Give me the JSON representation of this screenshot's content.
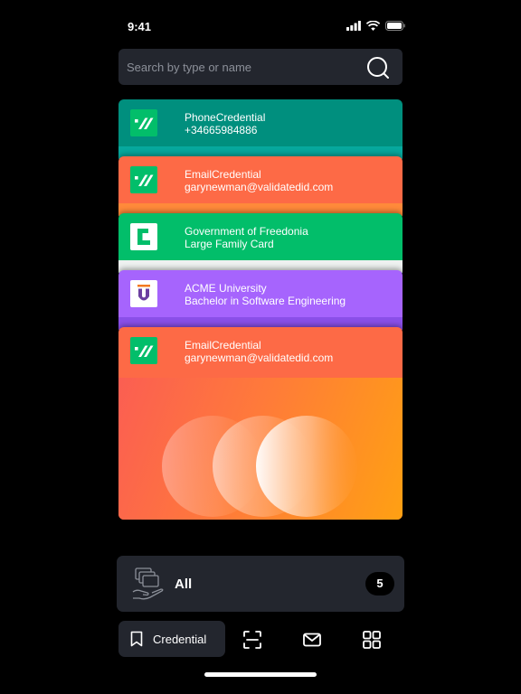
{
  "status_bar": {
    "time": "9:41"
  },
  "search": {
    "placeholder": "Search by type or name"
  },
  "cards": [
    {
      "title": "PhoneCredential",
      "subtitle": "+34665984886",
      "color": "#008f7e",
      "logo": "validated-id-logo"
    },
    {
      "title": "EmailCredential",
      "subtitle": "garynewman@validatedid.com",
      "color": "#fd6a46",
      "logo": "validated-id-logo"
    },
    {
      "title": "Government of Freedonia",
      "subtitle": "Large Family Card",
      "color": "#02be6a",
      "logo": "freedonia-logo"
    },
    {
      "title": "ACME University",
      "subtitle": "Bachelor in Software Engineering",
      "color": "#a664fd",
      "logo": "acme-university-logo"
    },
    {
      "title": "EmailCredential",
      "subtitle": "garynewman@validatedid.com",
      "color": "#fd6a46",
      "logo": "validated-id-logo"
    }
  ],
  "wallet": {
    "label": "All",
    "count": "5"
  },
  "nav": {
    "active_label": "Credential",
    "items": [
      "credential",
      "scan",
      "messages",
      "apps"
    ]
  },
  "colors": {
    "background": "#000000",
    "surface": "#23262e",
    "accent_green": "#02be6a"
  }
}
